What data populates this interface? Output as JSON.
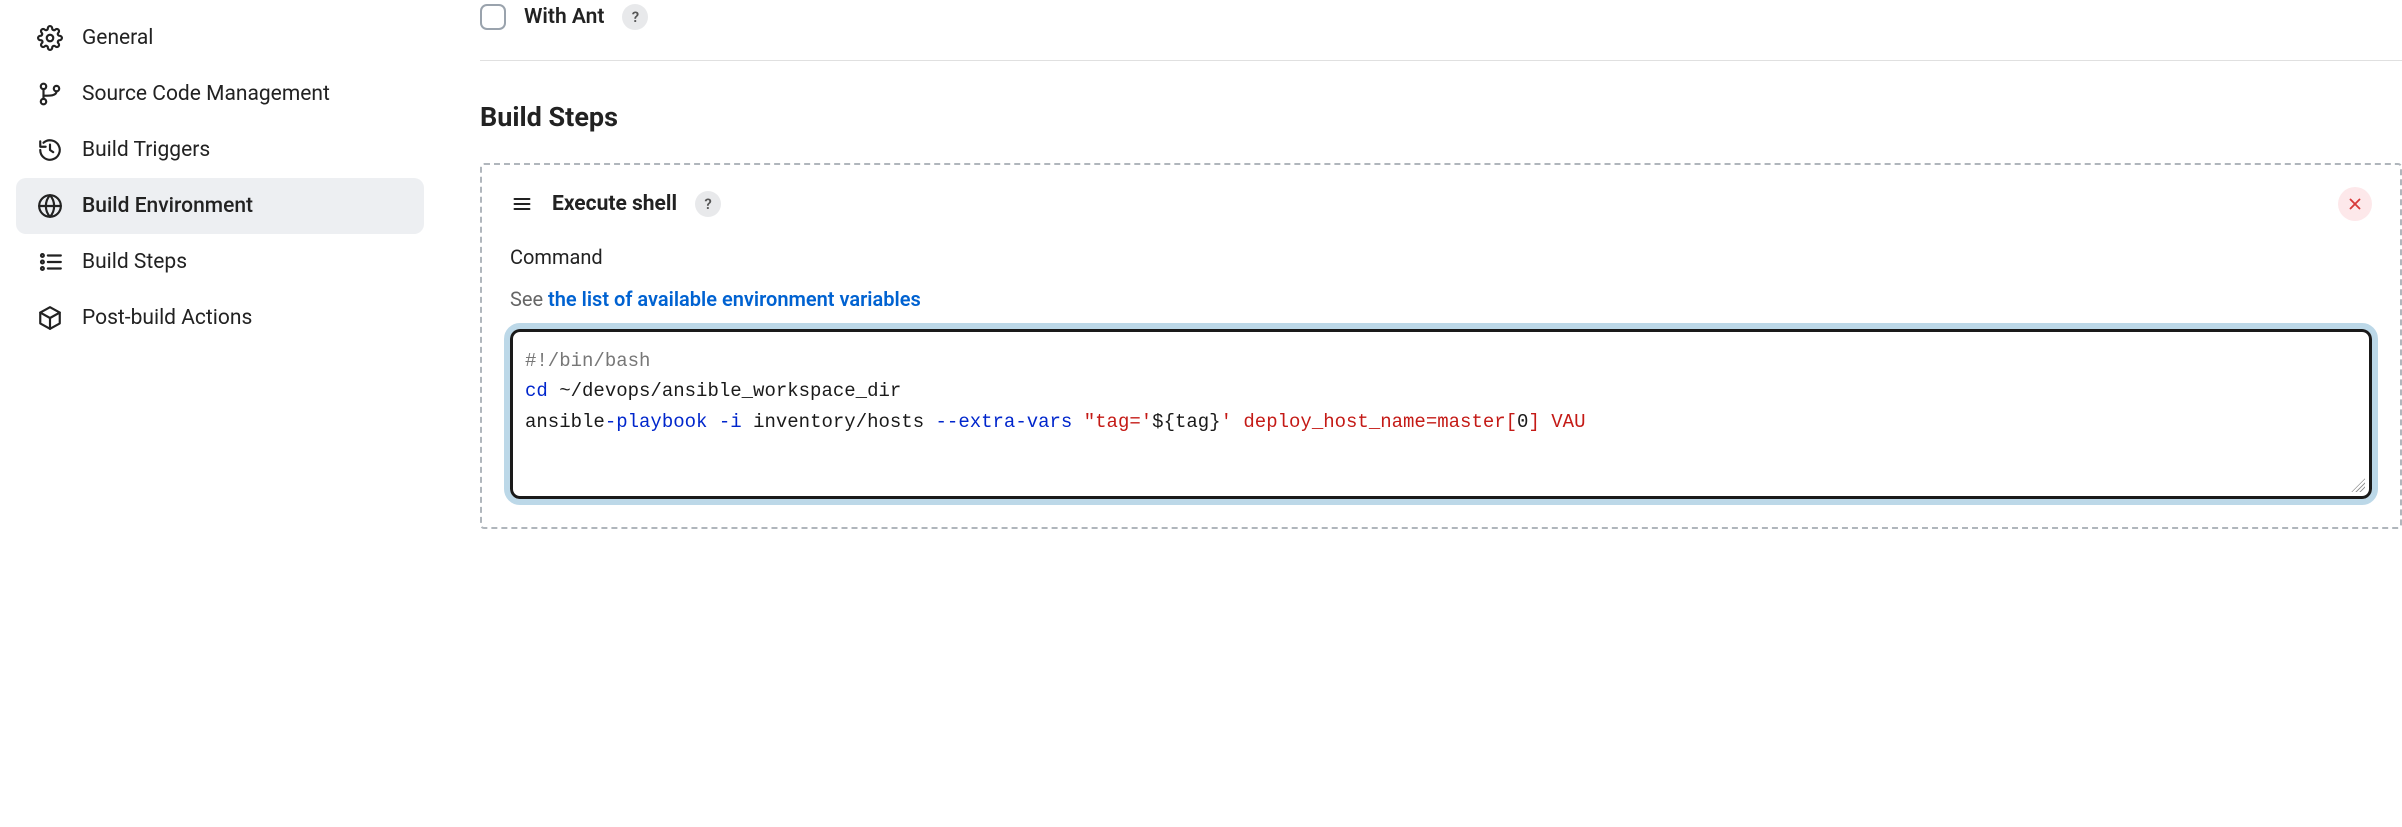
{
  "sidebar": {
    "items": [
      {
        "label": "General"
      },
      {
        "label": "Source Code Management"
      },
      {
        "label": "Build Triggers"
      },
      {
        "label": "Build Environment"
      },
      {
        "label": "Build Steps"
      },
      {
        "label": "Post-build Actions"
      }
    ],
    "activeIndex": 3
  },
  "withAnt": {
    "label": "With Ant",
    "checked": false
  },
  "buildSteps": {
    "title": "Build Steps",
    "step": {
      "title": "Execute shell",
      "commandLabel": "Command",
      "hintPrefix": "See ",
      "hintLinkText": "the list of available environment variables",
      "code": {
        "line1_shebang": "#!/bin/bash",
        "line2_cd": "cd",
        "line2_path": " ~/devops/ansible_workspace_dir",
        "line3_cmd": "ansible",
        "line3_playbook": "-playbook",
        "line3_i": " -i",
        "line3_hosts": " inventory/hosts ",
        "line3_extravars": "--extra-vars",
        "line3_gap": "  ",
        "line3_open": "\"tag='",
        "line3_tagexpr": "${tag}",
        "line3_close": "'",
        "line3_deploy": " deploy_host_name=master[",
        "line3_zero": "0",
        "line3_bracket": "]",
        "line3_tail": " VAU"
      }
    }
  },
  "helpGlyph": "?"
}
